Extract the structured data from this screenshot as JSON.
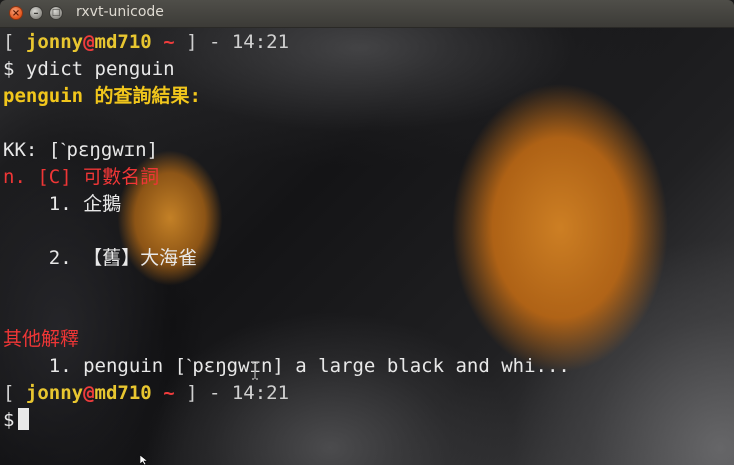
{
  "window": {
    "title": "rxvt-unicode",
    "close_glyph": "×",
    "minimize_glyph": "–",
    "maximize_glyph": "□"
  },
  "terminal": {
    "prompt1": {
      "open": "[ ",
      "user": "jonny",
      "at": "@",
      "host": "md710",
      "tilde": " ~ ",
      "close": "] - 14:21"
    },
    "command": "$ ydict penguin",
    "result_word": "penguin",
    "result_suffix": " 的查詢結果:",
    "kk_line": "KK: [ˋpɛŋgwɪn]",
    "pos_line": "n. [C] 可數名詞",
    "def1": "    1. 企鵝",
    "def2": "    2. 【舊】大海雀",
    "other_header": "其他解釋",
    "other1": "    1. penguin [ˋpɛŋgwɪn] a large black and whi...",
    "prompt2": {
      "open": "[ ",
      "user": "jonny",
      "at": "@",
      "host": "md710",
      "tilde": " ~ ",
      "close": "] - 14:21"
    },
    "input_prompt": "$"
  },
  "colors": {
    "user_host": "#e8c630",
    "at_tilde": "#ef3c3c",
    "heading_yellow": "#f1c61c",
    "label_red": "#ef3636",
    "text": "#e8e8e8"
  }
}
